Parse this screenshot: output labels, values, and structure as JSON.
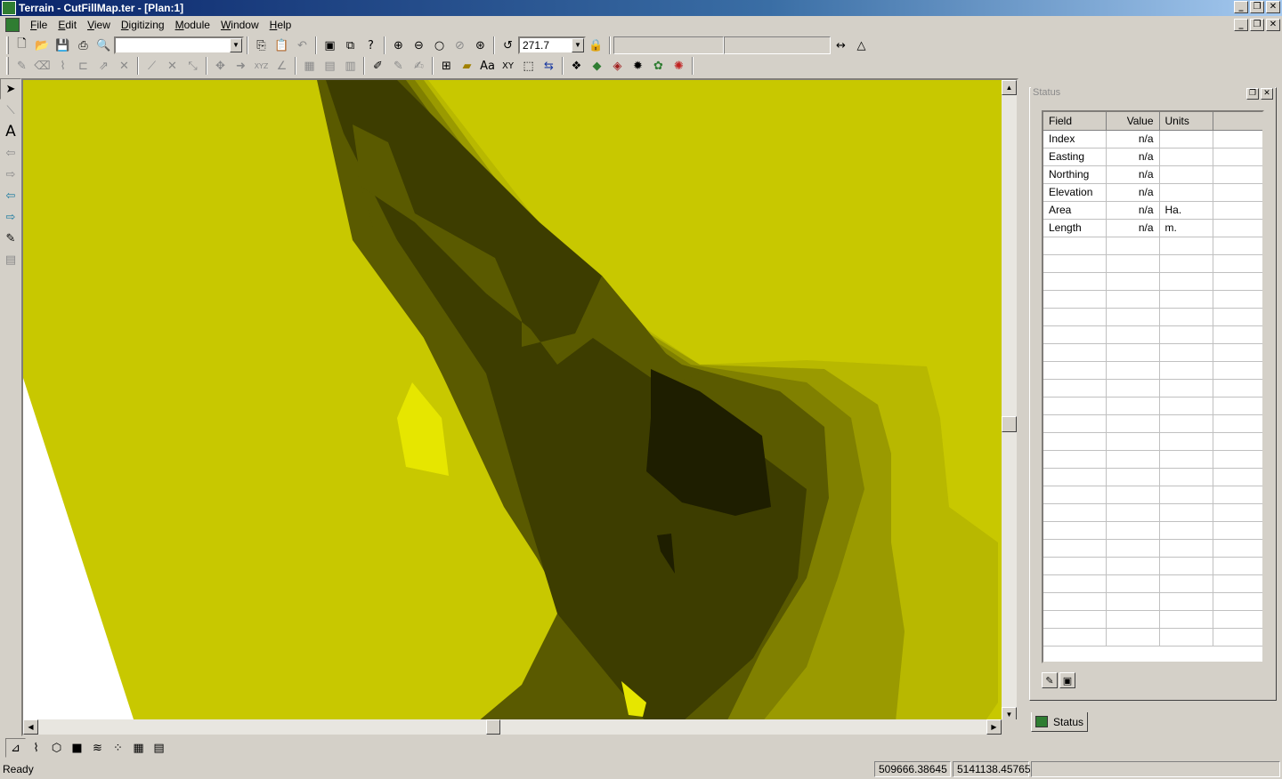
{
  "window": {
    "title": "Terrain - CutFillMap.ter - [Plan:1]"
  },
  "menu": {
    "items": [
      "File",
      "Edit",
      "View",
      "Digitizing",
      "Module",
      "Window",
      "Help"
    ]
  },
  "toolbar": {
    "layer_combo_value": "",
    "zoom_value": "271.7"
  },
  "status_panel": {
    "caption": "Status",
    "columns": [
      "Field",
      "Value",
      "Units"
    ],
    "rows": [
      {
        "field": "Index",
        "value": "n/a",
        "units": ""
      },
      {
        "field": "Easting",
        "value": "n/a",
        "units": ""
      },
      {
        "field": "Northing",
        "value": "n/a",
        "units": ""
      },
      {
        "field": "Elevation",
        "value": "n/a",
        "units": ""
      },
      {
        "field": "Area",
        "value": "n/a",
        "units": "Ha."
      },
      {
        "field": "Length",
        "value": "n/a",
        "units": "m."
      }
    ],
    "tab_label": "Status"
  },
  "statusbar": {
    "ready": "Ready",
    "easting": "509666.38645",
    "northing": "5141138.45765"
  },
  "colors": {
    "map_base": "#c8c800",
    "contour_1": "#9a9a00",
    "contour_2": "#6a6a00",
    "contour_3": "#3a3a00",
    "contour_4": "#1e1e00",
    "highlight": "#e6e600"
  }
}
